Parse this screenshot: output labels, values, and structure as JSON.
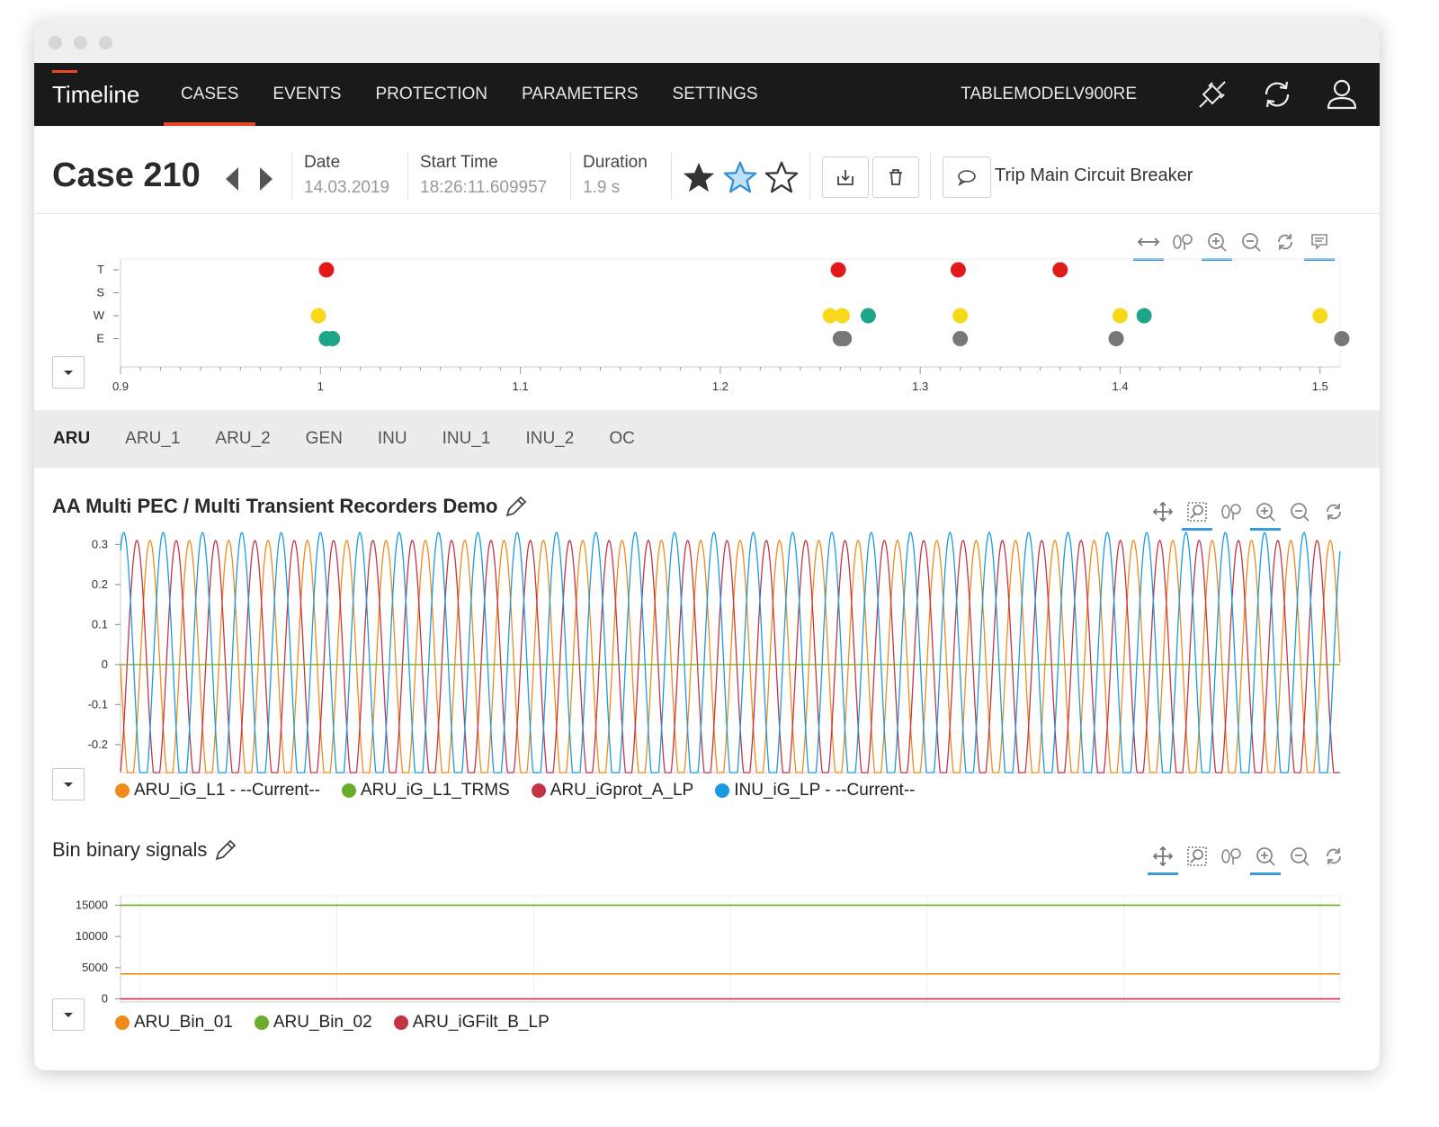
{
  "nav": {
    "brand": "Timeline",
    "links": [
      "CASES",
      "EVENTS",
      "PROTECTION",
      "PARAMETERS",
      "SETTINGS"
    ],
    "active_link": "CASES",
    "device": "TABLEMODELV900RE",
    "icons": [
      "plug-icon",
      "refresh-icon",
      "user-icon"
    ]
  },
  "case": {
    "title": "Case 210",
    "date_label": "Date",
    "date_value": "14.03.2019",
    "start_label": "Start Time",
    "start_value": "18:26:11.609957",
    "duration_label": "Duration",
    "duration_value": "1.9 s",
    "rating": [
      "filled",
      "blue-outline",
      "outline"
    ],
    "comment": "Trip Main Circuit Breaker"
  },
  "tabs": [
    "ARU",
    "ARU_1",
    "ARU_2",
    "GEN",
    "INU",
    "INU_1",
    "INU_2",
    "OC"
  ],
  "active_tab": "ARU",
  "colors": {
    "accent": "#e8472b",
    "highlight": "#3b9cdb",
    "orange": "#f28a1a",
    "green": "#6aad2a",
    "crimson": "#c43447",
    "blue": "#1a9be0",
    "red_dot": "#e11a1a",
    "yellow_dot": "#f7d91c",
    "teal_dot": "#1da58a",
    "gray_dot": "#777777"
  },
  "chart_data": [
    {
      "type": "scatter",
      "categories": [
        "T",
        "S",
        "W",
        "E"
      ],
      "xlim": [
        0.9,
        1.51
      ],
      "x_ticks": [
        "0.9",
        "1",
        "1.1",
        "1.2",
        "1.3",
        "1.4",
        "1.5"
      ],
      "series": [
        {
          "category": "T",
          "color": "red",
          "x": [
            1.003,
            1.259,
            1.319,
            1.37
          ]
        },
        {
          "category": "W",
          "color": "yellow",
          "x": [
            0.999,
            1.255,
            1.261,
            1.32,
            1.4,
            1.5
          ]
        },
        {
          "category": "W",
          "color": "teal",
          "x": [
            1.274,
            1.412
          ]
        },
        {
          "category": "E",
          "color": "teal",
          "x": [
            1.003,
            1.006
          ]
        },
        {
          "category": "E",
          "color": "gray",
          "x": [
            1.26,
            1.262,
            1.32,
            1.398,
            1.517
          ]
        }
      ]
    },
    {
      "type": "line",
      "title": "AA Multi PEC / Multi Transient Recorders Demo",
      "xlim": [
        0.89,
        1.51
      ],
      "ylim": [
        -0.27,
        0.33
      ],
      "x_ticks": [
        "0.9",
        "1",
        "1.1",
        "1.2",
        "1.3",
        "1.4",
        "1.5"
      ],
      "y_ticks": [
        "0.3",
        "0.2",
        "0.1",
        "0",
        "-0.1",
        "-0.2"
      ],
      "series": [
        {
          "name": "ARU_iG_L1 - --Current--",
          "amplitude": 0.31,
          "frequency_hz": 50,
          "phase_deg": 0
        },
        {
          "name": "ARU_iG_L1_TRMS",
          "value": 0
        },
        {
          "name": "ARU_iGprot_A_LP",
          "amplitude": 0.31,
          "frequency_hz": 50,
          "phase_deg": 120
        },
        {
          "name": "INU_iG_LP - --Current--",
          "amplitude": 0.33,
          "frequency_hz": 50,
          "phase_deg": 240
        }
      ]
    },
    {
      "type": "line",
      "title": "Bin binary signals",
      "xlim": [
        0.89,
        1.51
      ],
      "ylim": [
        -500,
        16500
      ],
      "x_ticks": [
        "0.9",
        "1",
        "1.1",
        "1.2",
        "1.3",
        "1.4",
        "1.5"
      ],
      "y_ticks": [
        "15000",
        "10000",
        "5000",
        "0"
      ],
      "series": [
        {
          "name": "ARU_Bin_01",
          "value": 4000
        },
        {
          "name": "ARU_Bin_02",
          "value": 15000
        },
        {
          "name": "ARU_iGFilt_B_LP",
          "value": 0
        }
      ]
    }
  ]
}
